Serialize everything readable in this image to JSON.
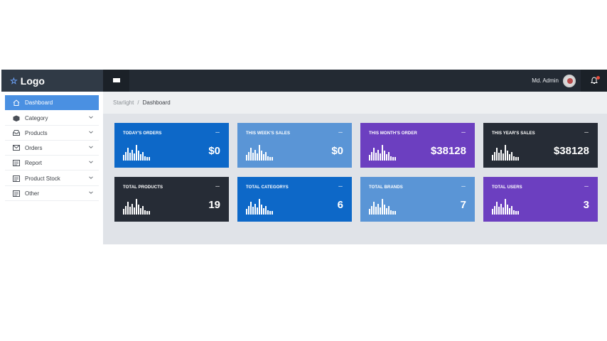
{
  "header": {
    "logo_text": "Logo",
    "logo_icon": "star-icon",
    "menu_icon": "hamburger-icon",
    "user_name": "Md. Admin",
    "notification_icon": "bell-icon"
  },
  "sidebar": {
    "items": [
      {
        "label": "Dashboard",
        "icon": "home-icon",
        "active": true
      },
      {
        "label": "Category",
        "icon": "box-icon",
        "expandable": true
      },
      {
        "label": "Products",
        "icon": "inbox-icon",
        "expandable": true
      },
      {
        "label": "Orders",
        "icon": "envelope-icon",
        "expandable": true
      },
      {
        "label": "Report",
        "icon": "list-icon",
        "expandable": true
      },
      {
        "label": "Product Stock",
        "icon": "list-icon",
        "expandable": true
      },
      {
        "label": "Other",
        "icon": "list-icon",
        "expandable": true
      }
    ]
  },
  "breadcrumb": {
    "root": "Starlight",
    "separator": "/",
    "current": "Dashboard"
  },
  "cards": [
    {
      "label": "TODAY'S ORDERS",
      "value": "$0",
      "more": "...",
      "color": "#0d68c8"
    },
    {
      "label": "THIS WEEK'S SALES",
      "value": "$0",
      "more": "...",
      "color": "#5a95d6"
    },
    {
      "label": "THIS MONTH'S ORDER",
      "value": "$38128",
      "more": "...",
      "color": "#6c3fc0"
    },
    {
      "label": "THIS YEAR'S SALES",
      "value": "$38128",
      "more": "...",
      "color": "#262c36"
    },
    {
      "label": "TOTAL PRODUCTS",
      "value": "19",
      "more": "...",
      "color": "#262c36"
    },
    {
      "label": "TOTAL CATEGORYS",
      "value": "6",
      "more": "...",
      "color": "#0d68c8"
    },
    {
      "label": "TOTAL BRANDS",
      "value": "7",
      "more": "...",
      "color": "#5a95d6"
    },
    {
      "label": "TOTAL USERS",
      "value": "3",
      "more": "...",
      "color": "#6c3fc0"
    }
  ],
  "colors": {
    "sidebar_active": "#4a90e2",
    "topbar": "#232a33",
    "brand_bar": "#303a46",
    "main_bg": "#e0e3e8"
  }
}
